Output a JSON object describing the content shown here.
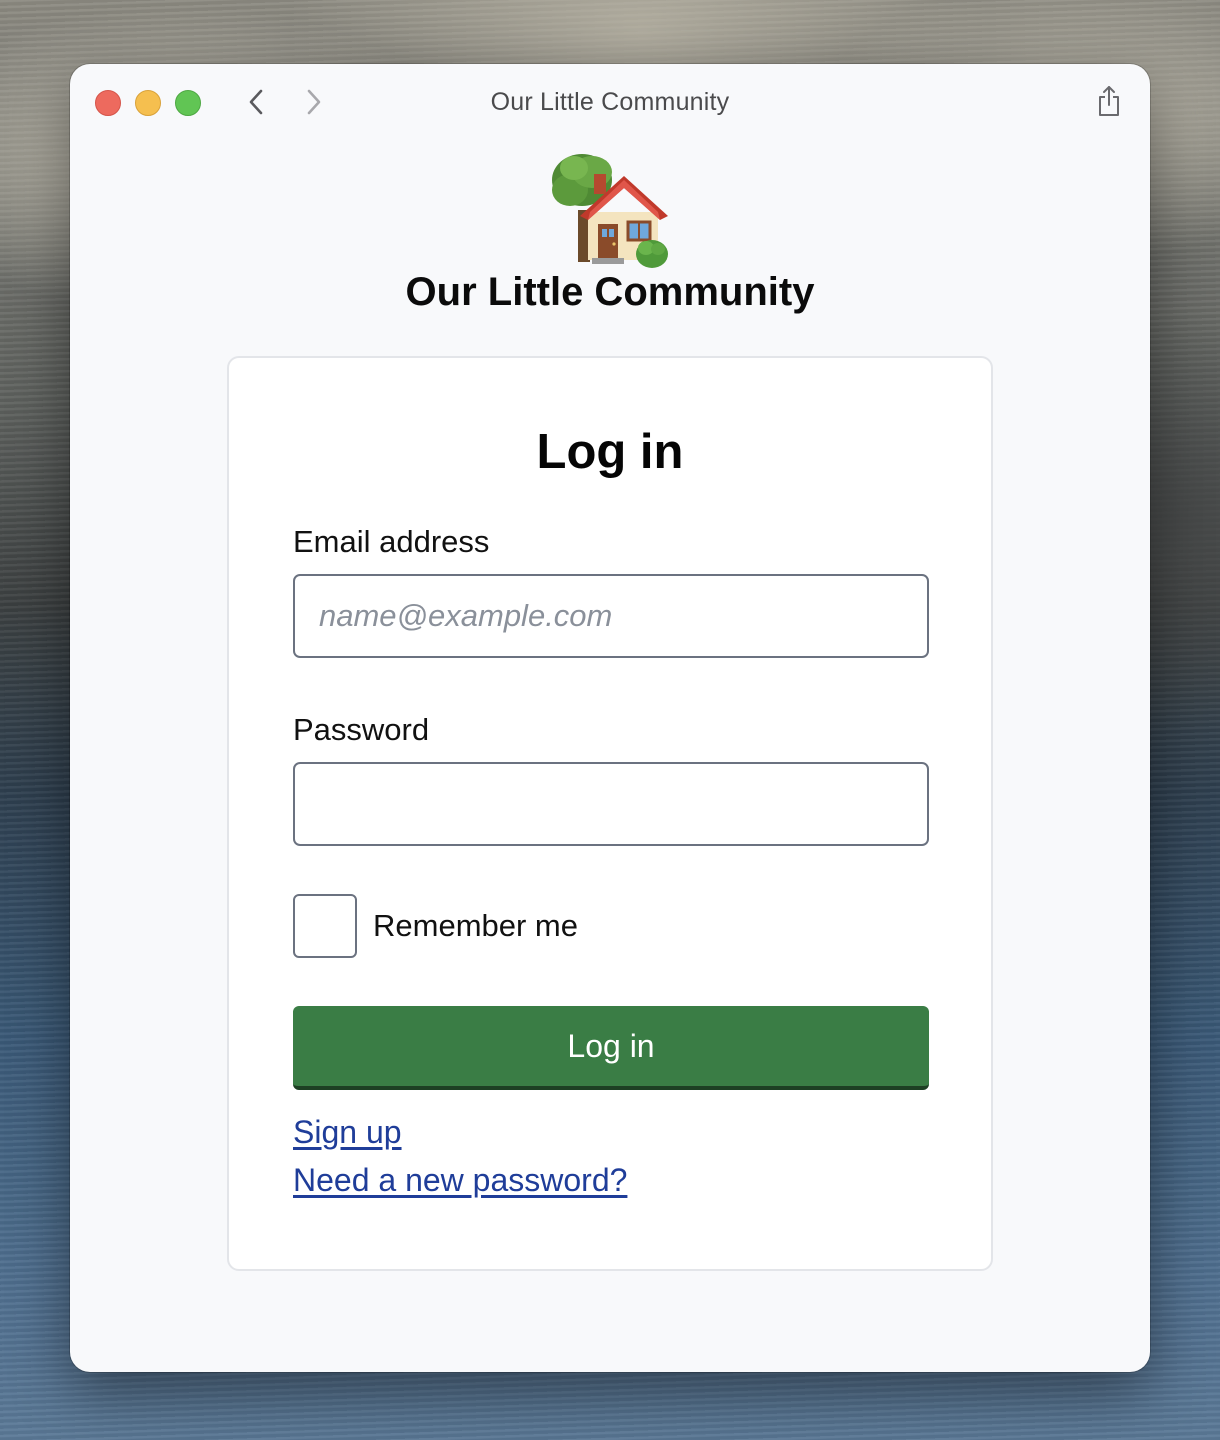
{
  "window": {
    "title": "Our Little Community"
  },
  "site": {
    "logo": "house-with-garden-icon",
    "title": "Our Little Community"
  },
  "form": {
    "heading": "Log in",
    "email_label": "Email address",
    "email_placeholder": "name@example.com",
    "email_value": "",
    "password_label": "Password",
    "password_value": "",
    "remember_label": "Remember me",
    "remember_checked": false,
    "submit_label": "Log in"
  },
  "links": {
    "signup": "Sign up",
    "reset_password": "Need a new password?"
  },
  "colors": {
    "primary_button": "#3a7d45",
    "link": "#1f3d99",
    "traffic_close": "#ed6a5e",
    "traffic_minimize": "#f5bf4f",
    "traffic_zoom": "#61c554"
  }
}
